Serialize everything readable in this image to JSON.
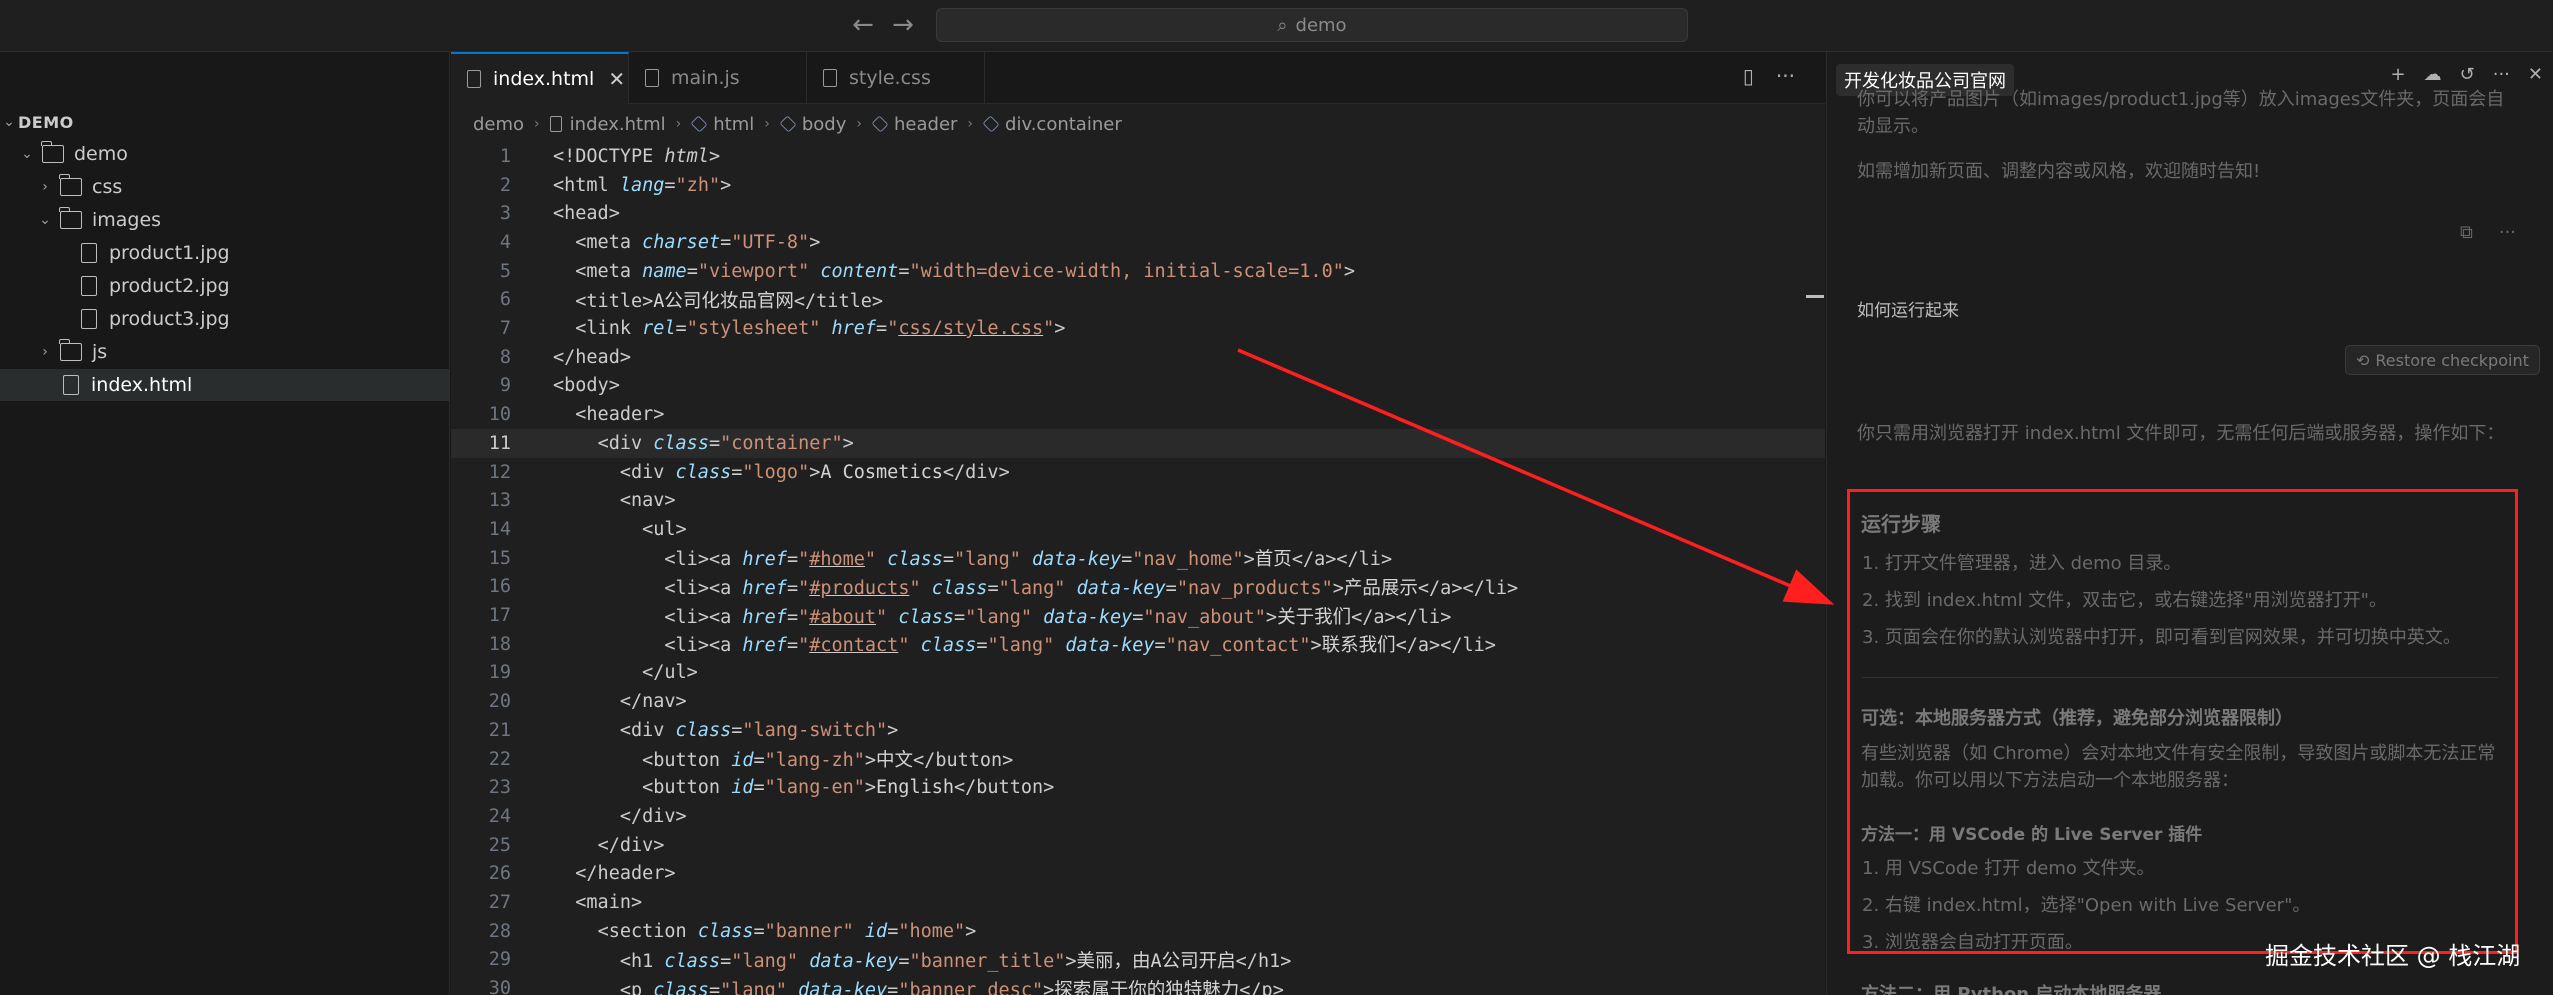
{
  "titlebar": {
    "back_arrow": "←",
    "forward_arrow": "→",
    "search_icon": "⌕",
    "search_label": "demo"
  },
  "explorer": {
    "root_label": "DEMO",
    "items": [
      {
        "label": "demo",
        "type": "folder",
        "open": true,
        "depth": 1
      },
      {
        "label": "css",
        "type": "folder",
        "open": false,
        "depth": 2
      },
      {
        "label": "images",
        "type": "folder",
        "open": true,
        "depth": 2
      },
      {
        "label": "product1.jpg",
        "type": "file",
        "depth": 3
      },
      {
        "label": "product2.jpg",
        "type": "file",
        "depth": 3
      },
      {
        "label": "product3.jpg",
        "type": "file",
        "depth": 3
      },
      {
        "label": "js",
        "type": "folder",
        "open": false,
        "depth": 2
      },
      {
        "label": "index.html",
        "type": "file",
        "depth": 2,
        "selected": true
      }
    ]
  },
  "editor": {
    "tabs": [
      {
        "label": "index.html",
        "active": true,
        "close": "✕"
      },
      {
        "label": "main.js",
        "active": false
      },
      {
        "label": "style.css",
        "active": false
      }
    ],
    "tab_actions": [
      "▯",
      "···"
    ],
    "breadcrumb": [
      "demo",
      "index.html",
      "html",
      "body",
      "header",
      "div.container"
    ],
    "current_line": 11,
    "lines": [
      "<!DOCTYPE html>",
      "<html lang=\"zh\">",
      "<head>",
      "  <meta charset=\"UTF-8\">",
      "  <meta name=\"viewport\" content=\"width=device-width, initial-scale=1.0\">",
      "  <title>A公司化妆品官网</title>",
      "  <link rel=\"stylesheet\" href=\"css/style.css\">",
      "</head>",
      "<body>",
      "  <header>",
      "    <div class=\"container\">",
      "      <div class=\"logo\">A Cosmetics</div>",
      "      <nav>",
      "        <ul>",
      "          <li><a href=\"#home\" class=\"lang\" data-key=\"nav_home\">首页</a></li>",
      "          <li><a href=\"#products\" class=\"lang\" data-key=\"nav_products\">产品展示</a></li>",
      "          <li><a href=\"#about\" class=\"lang\" data-key=\"nav_about\">关于我们</a></li>",
      "          <li><a href=\"#contact\" class=\"lang\" data-key=\"nav_contact\">联系我们</a></li>",
      "        </ul>",
      "      </nav>",
      "      <div class=\"lang-switch\">",
      "        <button id=\"lang-zh\">中文</button>",
      "        <button id=\"lang-en\">English</button>",
      "      </div>",
      "    </div>",
      "  </header>",
      "  <main>",
      "    <section class=\"banner\" id=\"home\">",
      "      <h1 class=\"lang\" data-key=\"banner_title\">美丽，由A公司开启</h1>",
      "      <p class=\"lang\" data-key=\"banner_desc\">探索属于你的独特魅力</p>"
    ]
  },
  "chat": {
    "title": "开发化妆品公司官网",
    "header_actions": [
      "+",
      "☁",
      "↺",
      "···",
      "✕"
    ],
    "prev_partial": "你可以将产品图片（如images/product1.jpg等）放入images文件夹，页面会自动显示。",
    "prev_line2": "如需增加新页面、调整内容或风格，欢迎随时告知!",
    "msg_actions": [
      "⧉",
      "···"
    ],
    "user_message": "如何运行起来",
    "restore_label": "Restore checkpoint",
    "intro": "你只需用浏览器打开 index.html 文件即可，无需任何后端或服务器，操作如下：",
    "steps_title": "运行步骤",
    "steps": [
      "1. 打开文件管理器，进入 demo 目录。",
      "2. 找到 index.html 文件，双击它，或右键选择\"用浏览器打开\"。",
      "3. 页面会在你的默认浏览器中打开，即可看到官网效果，并可切换中英文。"
    ],
    "optional_title": "可选：本地服务器方式（推荐，避免部分浏览器限制）",
    "optional_desc": "有些浏览器（如 Chrome）会对本地文件有安全限制，导致图片或脚本无法正常加载。你可以用以下方法启动一个本地服务器：",
    "method1_title": "方法一：用 VSCode 的 Live Server 插件",
    "method1_steps": [
      "1. 用 VSCode 打开 demo 文件夹。",
      "2. 右键 index.html，选择\"Open with Live Server\"。",
      "3. 浏览器会自动打开页面。"
    ],
    "method2_partial": "方法二：用 Python 启动本地服务器"
  },
  "watermark": "掘金技术社区 @ 栈江湖",
  "colors": {
    "highlight_box": "#ff1f1f",
    "arrow": "#ff1f1f",
    "tab_accent": "#0078d4"
  }
}
